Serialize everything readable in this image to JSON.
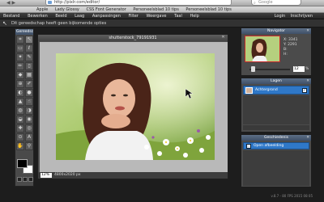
{
  "browser": {
    "url": "http://pixlr.com/editor/",
    "search_placeholder": "Google",
    "bookmarks": [
      "Apple",
      "Lady Glossy",
      "CSS Font Generator",
      "Personeelsblad 10 tips",
      "Personeelsblad 10 tips"
    ]
  },
  "menubar": {
    "items": [
      "Bestand",
      "Bewerken",
      "Beeld",
      "Laag",
      "Aanpassingen",
      "Filter",
      "Weergave",
      "Taal",
      "Help"
    ],
    "login": "Login",
    "signup": "Inschrijven"
  },
  "options_bar": {
    "text": "Dit gereedschap heeft geen bijkomende opties"
  },
  "tools": {
    "title": "Gereedschap",
    "icons": [
      "crop-icon",
      "move-icon",
      "marquee-icon",
      "lasso-icon",
      "wand-icon",
      "pencil-icon",
      "brush-icon",
      "eraser-icon",
      "bucket-icon",
      "gradient-icon",
      "clone-icon",
      "colorpicker-icon",
      "drawing-icon",
      "blur-icon",
      "sharpen-icon",
      "smudge-icon",
      "sponge-icon",
      "dodge-icon",
      "burn-icon",
      "redeye-icon",
      "spot-heal-icon",
      "bloat-icon",
      "pinch-icon",
      "text-icon",
      "hand-icon",
      "zoom-icon"
    ],
    "glyphs": [
      "⌗",
      "↖",
      "▭",
      "ℓ",
      "✦",
      "✎",
      "✏",
      "▯",
      "◆",
      "▦",
      "⊕",
      "✐",
      "◐",
      "●",
      "▲",
      "☝",
      "◍",
      "◑",
      "◒",
      "◉",
      "✚",
      "◎",
      "⊙",
      "A",
      "✋",
      "⚲"
    ]
  },
  "document": {
    "title": "shutterstock_79191931",
    "zoom": "12",
    "zoom_unit": "%",
    "size": "4800x2020 px"
  },
  "navigator": {
    "title": "Navigator",
    "x_label": "X:",
    "x_value": "3341",
    "y_label": "Y:",
    "y_value": "2291",
    "w_label": "B:",
    "h_label": "H:",
    "zoom": "12",
    "zoom_unit": "%"
  },
  "layers": {
    "title": "Lagen",
    "items": [
      {
        "name": "Achtergrond"
      }
    ]
  },
  "history": {
    "title": "Geschiedenis",
    "items": [
      {
        "name": "Open afbeelding"
      }
    ]
  },
  "footer": {
    "version": "v.8.7 - 80 FPS 2015 08 05"
  },
  "colors": {
    "foreground": "#000000",
    "background": "#ffffff",
    "selection": "#2f78c8",
    "panel_title": "#4a5e78"
  }
}
